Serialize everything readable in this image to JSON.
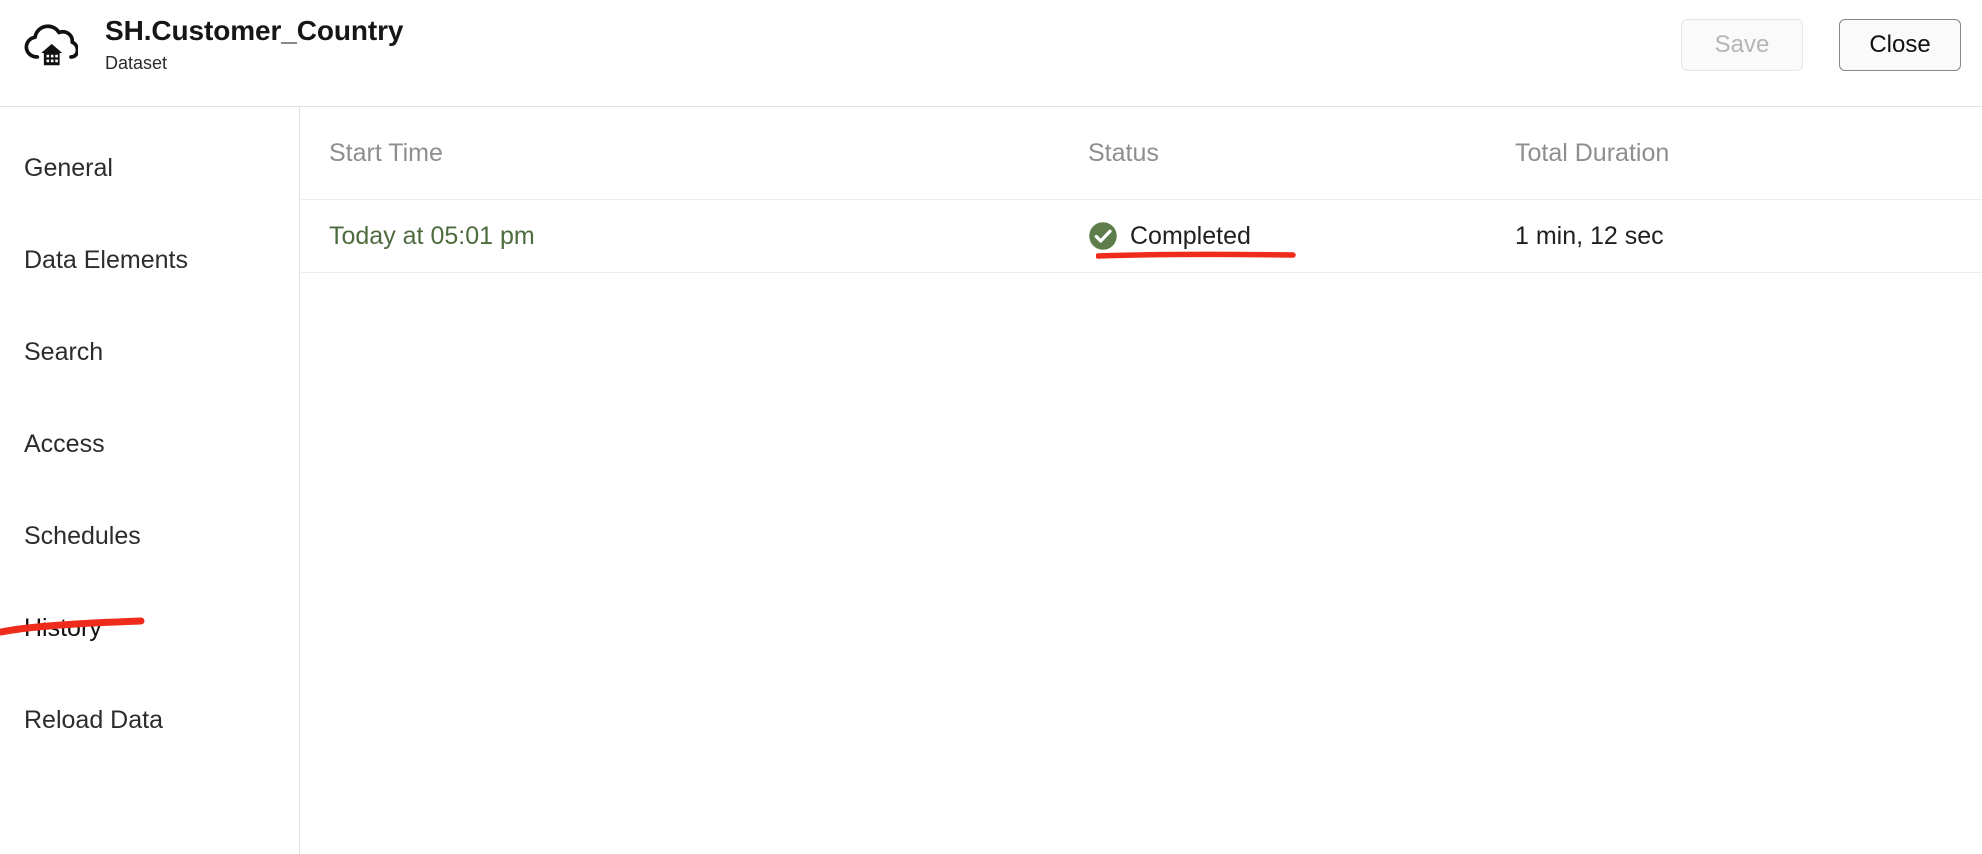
{
  "header": {
    "icon": "cloud-warehouse-icon",
    "title": "SH.Customer_Country",
    "subtitle": "Dataset",
    "save_label": "Save",
    "close_label": "Close",
    "save_disabled": true
  },
  "sidebar": {
    "items": [
      {
        "label": "General",
        "active": false
      },
      {
        "label": "Data Elements",
        "active": false
      },
      {
        "label": "Search",
        "active": false
      },
      {
        "label": "Access",
        "active": false
      },
      {
        "label": "Schedules",
        "active": false
      },
      {
        "label": "History",
        "active": true
      },
      {
        "label": "Reload Data",
        "active": false
      }
    ]
  },
  "main": {
    "table": {
      "columns": [
        "Start Time",
        "Status",
        "Total Duration"
      ],
      "rows": [
        {
          "start_time": "Today at 05:01 pm",
          "status": "Completed",
          "status_icon": "check-circle-icon",
          "total_duration": "1 min, 12 sec"
        }
      ]
    }
  },
  "annotations": [
    {
      "name": "history-underline",
      "target": "History",
      "color": "#ef2b1b"
    },
    {
      "name": "completed-underline",
      "target": "Completed",
      "color": "#ef2b1b"
    }
  ],
  "colors": {
    "status_green": "#5d7d4a",
    "link_green": "#4d6b3e",
    "annotation_red": "#ef2b1b",
    "border": "#e2e2e2",
    "muted_text": "#8e8e8e"
  }
}
